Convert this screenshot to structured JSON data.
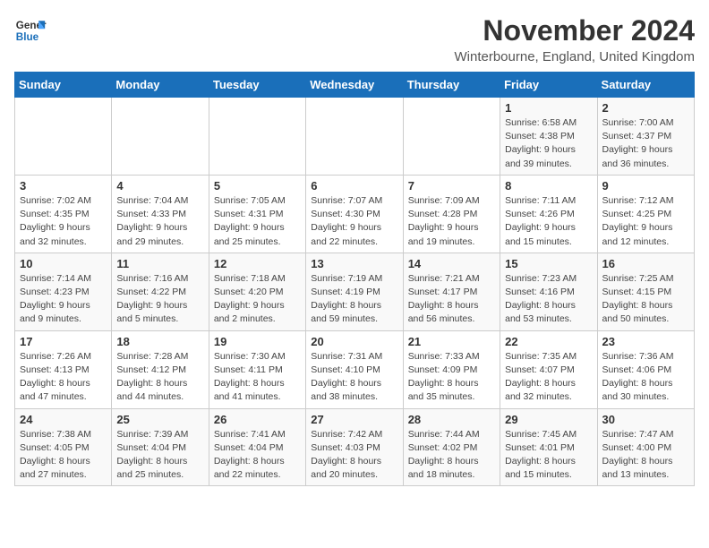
{
  "logo": {
    "line1": "General",
    "line2": "Blue"
  },
  "title": "November 2024",
  "location": "Winterbourne, England, United Kingdom",
  "days_of_week": [
    "Sunday",
    "Monday",
    "Tuesday",
    "Wednesday",
    "Thursday",
    "Friday",
    "Saturday"
  ],
  "weeks": [
    [
      {
        "day": "",
        "info": ""
      },
      {
        "day": "",
        "info": ""
      },
      {
        "day": "",
        "info": ""
      },
      {
        "day": "",
        "info": ""
      },
      {
        "day": "",
        "info": ""
      },
      {
        "day": "1",
        "info": "Sunrise: 6:58 AM\nSunset: 4:38 PM\nDaylight: 9 hours and 39 minutes."
      },
      {
        "day": "2",
        "info": "Sunrise: 7:00 AM\nSunset: 4:37 PM\nDaylight: 9 hours and 36 minutes."
      }
    ],
    [
      {
        "day": "3",
        "info": "Sunrise: 7:02 AM\nSunset: 4:35 PM\nDaylight: 9 hours and 32 minutes."
      },
      {
        "day": "4",
        "info": "Sunrise: 7:04 AM\nSunset: 4:33 PM\nDaylight: 9 hours and 29 minutes."
      },
      {
        "day": "5",
        "info": "Sunrise: 7:05 AM\nSunset: 4:31 PM\nDaylight: 9 hours and 25 minutes."
      },
      {
        "day": "6",
        "info": "Sunrise: 7:07 AM\nSunset: 4:30 PM\nDaylight: 9 hours and 22 minutes."
      },
      {
        "day": "7",
        "info": "Sunrise: 7:09 AM\nSunset: 4:28 PM\nDaylight: 9 hours and 19 minutes."
      },
      {
        "day": "8",
        "info": "Sunrise: 7:11 AM\nSunset: 4:26 PM\nDaylight: 9 hours and 15 minutes."
      },
      {
        "day": "9",
        "info": "Sunrise: 7:12 AM\nSunset: 4:25 PM\nDaylight: 9 hours and 12 minutes."
      }
    ],
    [
      {
        "day": "10",
        "info": "Sunrise: 7:14 AM\nSunset: 4:23 PM\nDaylight: 9 hours and 9 minutes."
      },
      {
        "day": "11",
        "info": "Sunrise: 7:16 AM\nSunset: 4:22 PM\nDaylight: 9 hours and 5 minutes."
      },
      {
        "day": "12",
        "info": "Sunrise: 7:18 AM\nSunset: 4:20 PM\nDaylight: 9 hours and 2 minutes."
      },
      {
        "day": "13",
        "info": "Sunrise: 7:19 AM\nSunset: 4:19 PM\nDaylight: 8 hours and 59 minutes."
      },
      {
        "day": "14",
        "info": "Sunrise: 7:21 AM\nSunset: 4:17 PM\nDaylight: 8 hours and 56 minutes."
      },
      {
        "day": "15",
        "info": "Sunrise: 7:23 AM\nSunset: 4:16 PM\nDaylight: 8 hours and 53 minutes."
      },
      {
        "day": "16",
        "info": "Sunrise: 7:25 AM\nSunset: 4:15 PM\nDaylight: 8 hours and 50 minutes."
      }
    ],
    [
      {
        "day": "17",
        "info": "Sunrise: 7:26 AM\nSunset: 4:13 PM\nDaylight: 8 hours and 47 minutes."
      },
      {
        "day": "18",
        "info": "Sunrise: 7:28 AM\nSunset: 4:12 PM\nDaylight: 8 hours and 44 minutes."
      },
      {
        "day": "19",
        "info": "Sunrise: 7:30 AM\nSunset: 4:11 PM\nDaylight: 8 hours and 41 minutes."
      },
      {
        "day": "20",
        "info": "Sunrise: 7:31 AM\nSunset: 4:10 PM\nDaylight: 8 hours and 38 minutes."
      },
      {
        "day": "21",
        "info": "Sunrise: 7:33 AM\nSunset: 4:09 PM\nDaylight: 8 hours and 35 minutes."
      },
      {
        "day": "22",
        "info": "Sunrise: 7:35 AM\nSunset: 4:07 PM\nDaylight: 8 hours and 32 minutes."
      },
      {
        "day": "23",
        "info": "Sunrise: 7:36 AM\nSunset: 4:06 PM\nDaylight: 8 hours and 30 minutes."
      }
    ],
    [
      {
        "day": "24",
        "info": "Sunrise: 7:38 AM\nSunset: 4:05 PM\nDaylight: 8 hours and 27 minutes."
      },
      {
        "day": "25",
        "info": "Sunrise: 7:39 AM\nSunset: 4:04 PM\nDaylight: 8 hours and 25 minutes."
      },
      {
        "day": "26",
        "info": "Sunrise: 7:41 AM\nSunset: 4:04 PM\nDaylight: 8 hours and 22 minutes."
      },
      {
        "day": "27",
        "info": "Sunrise: 7:42 AM\nSunset: 4:03 PM\nDaylight: 8 hours and 20 minutes."
      },
      {
        "day": "28",
        "info": "Sunrise: 7:44 AM\nSunset: 4:02 PM\nDaylight: 8 hours and 18 minutes."
      },
      {
        "day": "29",
        "info": "Sunrise: 7:45 AM\nSunset: 4:01 PM\nDaylight: 8 hours and 15 minutes."
      },
      {
        "day": "30",
        "info": "Sunrise: 7:47 AM\nSunset: 4:00 PM\nDaylight: 8 hours and 13 minutes."
      }
    ]
  ]
}
